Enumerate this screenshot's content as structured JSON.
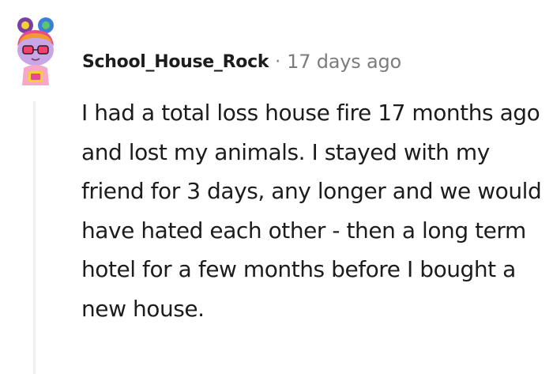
{
  "comment": {
    "author": "School_House_Rock",
    "separator": "·",
    "timestamp": "17 days ago",
    "body": "I had a total loss house fire 17 months ago and lost my animals. I stayed with my friend for 3 days, any longer and we would have hated each other - then a long term hotel for a few months before I bought a new house."
  },
  "colors": {
    "author": "#1c1c1c",
    "meta": "#7c7c7c",
    "thread_line": "#edeff1",
    "body_text": "#1c1c1c"
  },
  "icons": {
    "avatar": "snoo-avatar-icon"
  }
}
